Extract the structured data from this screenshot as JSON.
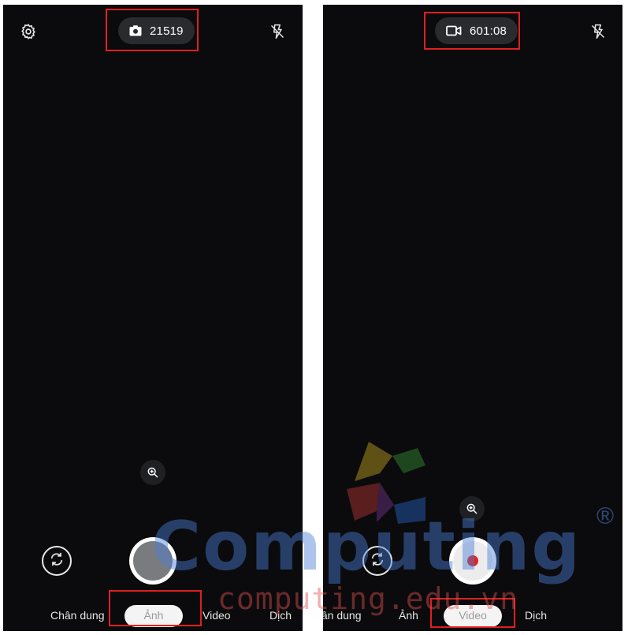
{
  "left_screen": {
    "counter": {
      "icon": "camera-icon",
      "value": "21519"
    },
    "icons": {
      "settings": "gear-icon",
      "flash": "flash-off-icon",
      "zoom": "zoom-in-icon",
      "switch": "switch-camera-icon"
    },
    "modes": [
      "Chân dung",
      "Ảnh",
      "Video",
      "Dịch"
    ],
    "active_mode": "Ảnh"
  },
  "right_screen": {
    "counter": {
      "icon": "video-camera-icon",
      "value": "601:08"
    },
    "icons": {
      "flash": "flash-off-icon",
      "zoom": "zoom-in-icon",
      "switch": "switch-camera-icon"
    },
    "modes": [
      "Chân dung",
      "Ảnh",
      "Video",
      "Dịch"
    ],
    "active_mode": "Video"
  },
  "watermark": {
    "brand": "Computing",
    "registered": "®",
    "url": "computing.edu.vn"
  },
  "colors": {
    "screen_bg": "#0b0b0d",
    "highlight_box": "#e02020",
    "record_dot": "#e02424",
    "watermark_blue": "#4a7fd6",
    "watermark_red": "#e05050"
  }
}
